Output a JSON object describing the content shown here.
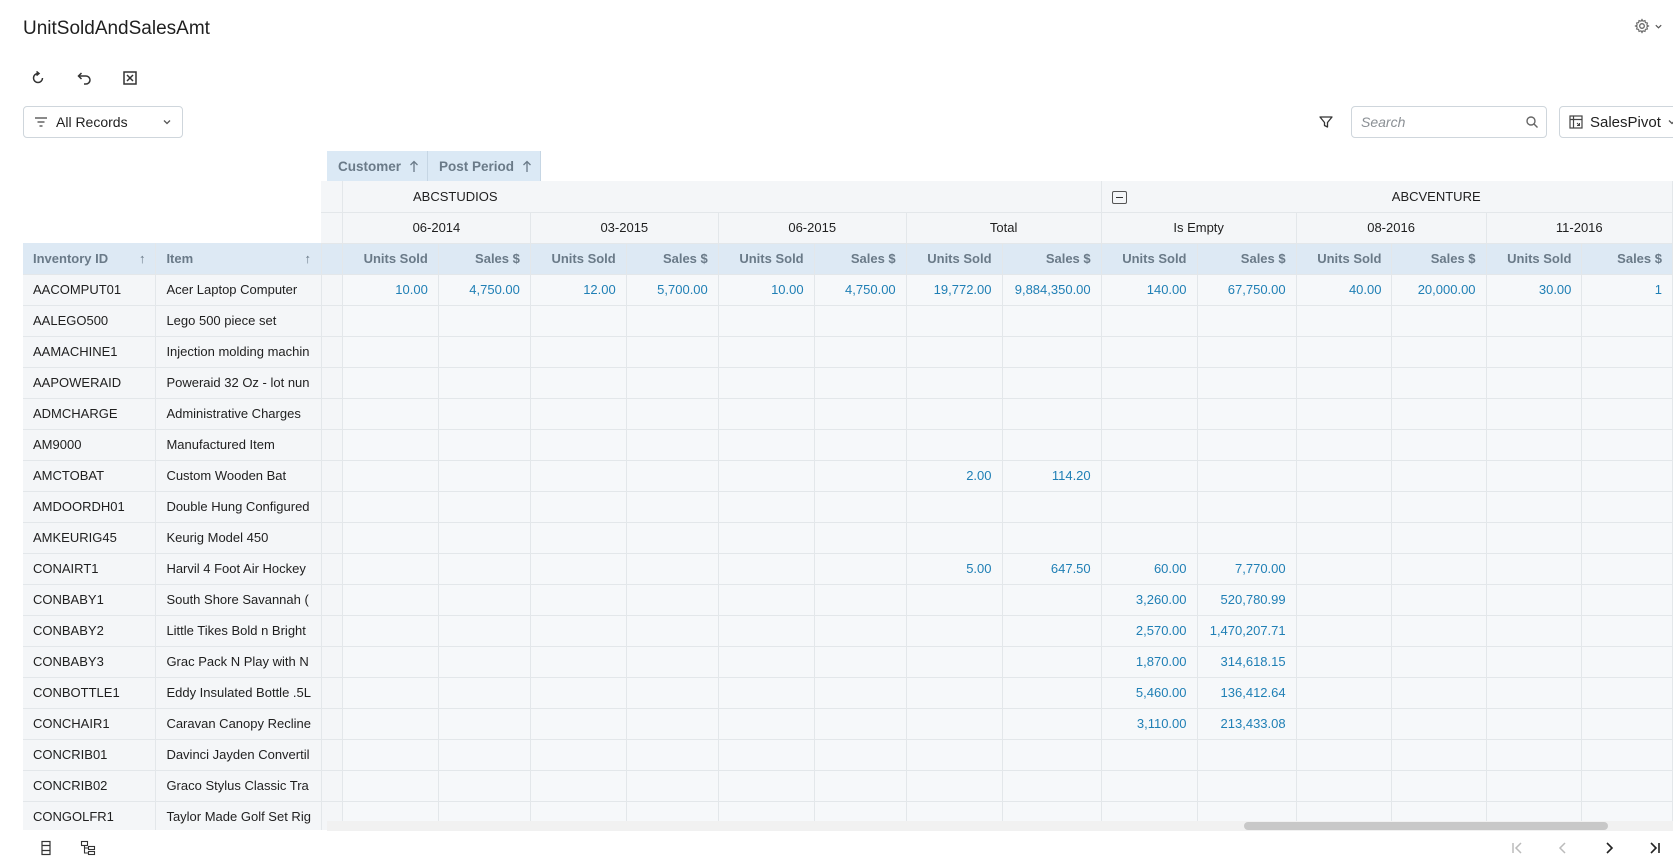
{
  "header": {
    "title": "UnitSoldAndSalesAmt"
  },
  "filter": {
    "selected": "All Records"
  },
  "search": {
    "placeholder": "Search"
  },
  "pivot_select": {
    "selected": "SalesPivot"
  },
  "field_chips": [
    {
      "label": "Customer"
    },
    {
      "label": "Post Period"
    }
  ],
  "grid": {
    "groups": [
      {
        "label": "ABCSTUDIOS"
      },
      {
        "label": "ABCVENTURE"
      }
    ],
    "periods": [
      "06-2014",
      "03-2015",
      "06-2015",
      "Total",
      "Is Empty",
      "08-2016",
      "11-2016"
    ],
    "measure_labels": {
      "units": "Units Sold",
      "sales": "Sales $"
    },
    "row_headers": {
      "inventory_id": "Inventory ID",
      "item": "Item"
    },
    "rows": [
      {
        "id": "AACOMPUT01",
        "item": "Acer Laptop Computer",
        "cells": [
          "10.00",
          "4,750.00",
          "12.00",
          "5,700.00",
          "10.00",
          "4,750.00",
          "19,772.00",
          "9,884,350.00",
          "140.00",
          "67,750.00",
          "40.00",
          "20,000.00",
          "30.00",
          "1"
        ]
      },
      {
        "id": "AALEGO500",
        "item": "Lego 500 piece set",
        "cells": [
          "",
          "",
          "",
          "",
          "",
          "",
          "",
          "",
          "",
          "",
          "",
          "",
          "",
          ""
        ]
      },
      {
        "id": "AAMACHINE1",
        "item": "Injection molding machin",
        "cells": [
          "",
          "",
          "",
          "",
          "",
          "",
          "",
          "",
          "",
          "",
          "",
          "",
          "",
          ""
        ]
      },
      {
        "id": "AAPOWERAID",
        "item": "Poweraid 32 Oz - lot nun",
        "cells": [
          "",
          "",
          "",
          "",
          "",
          "",
          "",
          "",
          "",
          "",
          "",
          "",
          "",
          ""
        ]
      },
      {
        "id": "ADMCHARGE",
        "item": "Administrative Charges",
        "cells": [
          "",
          "",
          "",
          "",
          "",
          "",
          "",
          "",
          "",
          "",
          "",
          "",
          "",
          ""
        ]
      },
      {
        "id": "AM9000",
        "item": "Manufactured Item",
        "cells": [
          "",
          "",
          "",
          "",
          "",
          "",
          "",
          "",
          "",
          "",
          "",
          "",
          "",
          ""
        ]
      },
      {
        "id": "AMCTOBAT",
        "item": "Custom Wooden Bat",
        "cells": [
          "",
          "",
          "",
          "",
          "",
          "",
          "2.00",
          "114.20",
          "",
          "",
          "",
          "",
          "",
          ""
        ]
      },
      {
        "id": "AMDOORDH01",
        "item": "Double Hung Configured",
        "cells": [
          "",
          "",
          "",
          "",
          "",
          "",
          "",
          "",
          "",
          "",
          "",
          "",
          "",
          ""
        ]
      },
      {
        "id": "AMKEURIG45",
        "item": "Keurig Model 450",
        "cells": [
          "",
          "",
          "",
          "",
          "",
          "",
          "",
          "",
          "",
          "",
          "",
          "",
          "",
          ""
        ]
      },
      {
        "id": "CONAIRT1",
        "item": "Harvil 4 Foot Air Hockey",
        "cells": [
          "",
          "",
          "",
          "",
          "",
          "",
          "5.00",
          "647.50",
          "60.00",
          "7,770.00",
          "",
          "",
          "",
          ""
        ]
      },
      {
        "id": "CONBABY1",
        "item": "South Shore Savannah (",
        "cells": [
          "",
          "",
          "",
          "",
          "",
          "",
          "",
          "",
          "3,260.00",
          "520,780.99",
          "",
          "",
          "",
          ""
        ]
      },
      {
        "id": "CONBABY2",
        "item": "Little Tikes Bold n Bright",
        "cells": [
          "",
          "",
          "",
          "",
          "",
          "",
          "",
          "",
          "2,570.00",
          "1,470,207.71",
          "",
          "",
          "",
          ""
        ]
      },
      {
        "id": "CONBABY3",
        "item": "Grac Pack N Play with N",
        "cells": [
          "",
          "",
          "",
          "",
          "",
          "",
          "",
          "",
          "1,870.00",
          "314,618.15",
          "",
          "",
          "",
          ""
        ]
      },
      {
        "id": "CONBOTTLE1",
        "item": "Eddy Insulated Bottle .5L",
        "cells": [
          "",
          "",
          "",
          "",
          "",
          "",
          "",
          "",
          "5,460.00",
          "136,412.64",
          "",
          "",
          "",
          ""
        ]
      },
      {
        "id": "CONCHAIR1",
        "item": "Caravan Canopy Recline",
        "cells": [
          "",
          "",
          "",
          "",
          "",
          "",
          "",
          "",
          "3,110.00",
          "213,433.08",
          "",
          "",
          "",
          ""
        ]
      },
      {
        "id": "CONCRIB01",
        "item": "Davinci Jayden Convertil",
        "cells": [
          "",
          "",
          "",
          "",
          "",
          "",
          "",
          "",
          "",
          "",
          "",
          "",
          "",
          ""
        ]
      },
      {
        "id": "CONCRIB02",
        "item": "Graco Stylus Classic Tra",
        "cells": [
          "",
          "",
          "",
          "",
          "",
          "",
          "",
          "",
          "",
          "",
          "",
          "",
          "",
          ""
        ]
      },
      {
        "id": "CONGOLFR1",
        "item": "Taylor Made Golf Set Rig",
        "cells": [
          "",
          "",
          "",
          "",
          "",
          "",
          "",
          "",
          "",
          "",
          "",
          "",
          "",
          ""
        ]
      }
    ]
  },
  "icons": {
    "refresh": "refresh-icon",
    "undo": "undo-icon",
    "excel": "excel-export-icon",
    "settings": "gear-icon"
  }
}
